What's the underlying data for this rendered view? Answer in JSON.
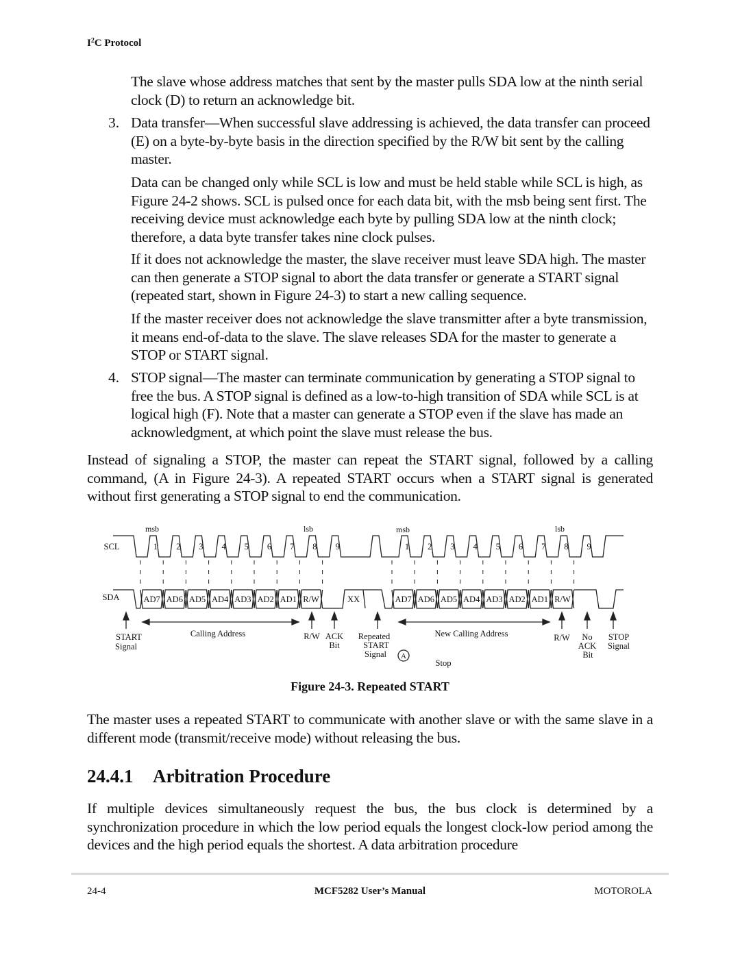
{
  "header": {
    "title_prefix": "I",
    "title_sup": "2",
    "title_rest": "C Protocol"
  },
  "body": {
    "p1": "The slave whose address matches that sent by the master pulls SDA low at the ninth serial clock (D) to return an acknowledge bit.",
    "item3_num": "3.",
    "item3": "Data transfer—When successful slave addressing is achieved, the data transfer can proceed (E) on a byte-by-byte basis in the direction specified by the R/W bit sent by the calling master.",
    "p2": "Data can be changed only while SCL is low and must be held stable while SCL is high, as Figure 24-2 shows. SCL is pulsed once for each data bit, with the msb being sent first. The receiving device must acknowledge each byte by pulling SDA low at the ninth clock; therefore, a data byte transfer takes nine clock pulses.",
    "p3": "If it does not acknowledge the master, the slave receiver must leave SDA high. The master can then generate a STOP signal to abort the data transfer or generate a START signal (repeated start, shown in Figure 24-3) to start a new calling sequence.",
    "p4": "If the master receiver does not acknowledge the slave transmitter after a byte transmission, it means end-of-data to the slave. The slave releases SDA for the master to generate a STOP or START signal.",
    "item4_num": "4.",
    "item4": "STOP signal—The master can terminate communication by generating a STOP signal to free the bus. A STOP signal is defined as a low-to-high transition of SDA while SCL is at logical high (F). Note that a master can generate a STOP even if the slave has made an acknowledgment, at which point the slave must release the bus.",
    "p5": "Instead of signaling a STOP, the master can repeat the START signal, followed by a calling command, (A in Figure 24-3). A repeated START occurs when a START signal is generated without first generating a STOP signal to end the communication.",
    "p6": "The master uses a repeated START to communicate with another slave or with the same slave in a different mode (transmit/receive mode) without releasing the bus.",
    "p7": "If multiple devices simultaneously request the bus, the bus clock is determined by a synchronization procedure in which the low period equals the longest clock-low period among the devices and the high period equals the shortest. A data arbitration procedure"
  },
  "figure": {
    "caption": "Figure 24-3. Repeated START",
    "scl_label": "SCL",
    "sda_label": "SDA",
    "msb_label": "msb",
    "lsb_label": "lsb",
    "clock_numbers": [
      "1",
      "2",
      "3",
      "4",
      "5",
      "6",
      "7",
      "8",
      "9"
    ],
    "bits_first": [
      "AD7",
      "AD6",
      "AD5",
      "AD4",
      "AD3",
      "AD2",
      "AD1",
      "R/W"
    ],
    "bits_second": [
      "AD7",
      "AD6",
      "AD5",
      "AD4",
      "AD3",
      "AD2",
      "AD1",
      "R/W"
    ],
    "xx_label": "XX",
    "annotations": {
      "start_signal": [
        "START",
        "Signal"
      ],
      "calling_address": "Calling Address",
      "rw1": "R/W",
      "ack_bit": [
        "ACK",
        "Bit"
      ],
      "repeated_start": [
        "Repeated",
        "START",
        "Signal"
      ],
      "marker_a": "A",
      "new_calling_address": "New Calling Address",
      "stop_note": "Stop",
      "rw2": "R/W",
      "no_ack_bit": [
        "No",
        "ACK",
        "Bit"
      ],
      "stop_signal": [
        "STOP",
        "Signal"
      ]
    }
  },
  "section": {
    "number": "24.4.1",
    "title": "Arbitration Procedure"
  },
  "footer": {
    "page": "24-4",
    "manual": "MCF5282 User’s Manual",
    "company": "MOTOROLA"
  }
}
